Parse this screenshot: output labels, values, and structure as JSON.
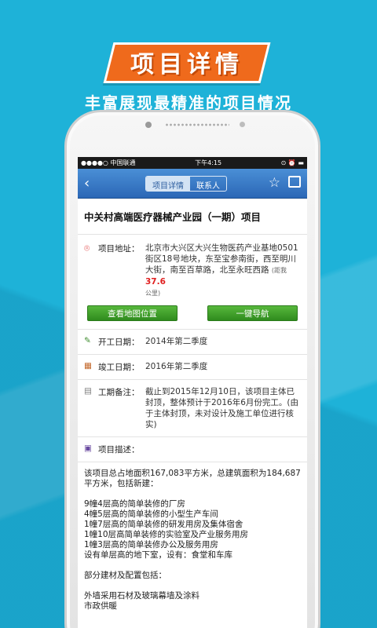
{
  "banner": {
    "title": "项目详情",
    "subtitle": "丰富展现最精准的项目情况"
  },
  "status": {
    "carrier": "●●●●○ 中国联通",
    "time": "下午4:15",
    "right": "⊙ ⏰ ▬"
  },
  "nav": {
    "back": "‹",
    "tabs": [
      "项目详情",
      "联系人"
    ]
  },
  "project": {
    "title": "中关村高端医疗器械产业园（一期）项目",
    "address_label": "项目地址：",
    "address": "北京市大兴区大兴生物医药产业基地0501街区18号地块，东至宝参南街，西至明川大街，南至百草路，北至永旺西路",
    "distance_prefix": "(距我",
    "distance": "37.6",
    "distance_suffix": "公里)",
    "map_button": "查看地图位置",
    "nav_button": "一键导航",
    "start_label": "开工日期：",
    "start": "2014年第二季度",
    "finish_label": "竣工日期：",
    "finish": "2016年第二季度",
    "note_label": "工期备注：",
    "note": "截止到2015年12月10日，该项目主体已封顶，整体预计于2016年6月份完工。(由于主体封顶，未对设计及施工单位进行核实)",
    "desc_label": "项目描述：",
    "desc_lines": [
      "该项目总占地面积167,083平方米，总建筑面积为184,687平方米，包括新建：",
      "",
      "9幢4层高的简单装修的厂房",
      "4幢5层高的简单装修的小型生产车间",
      "1幢7层高的简单装修的研发用房及集体宿舍",
      "1幢10层高简单装修的实验室及产业服务用房",
      "1幢3层高的简单装修办公及服务用房",
      "设有单层高的地下室，设有：食堂和车库",
      "",
      "部分建材及配置包括：",
      "",
      "外墙采用石材及玻璃幕墙及涂料",
      "市政供暖"
    ]
  }
}
